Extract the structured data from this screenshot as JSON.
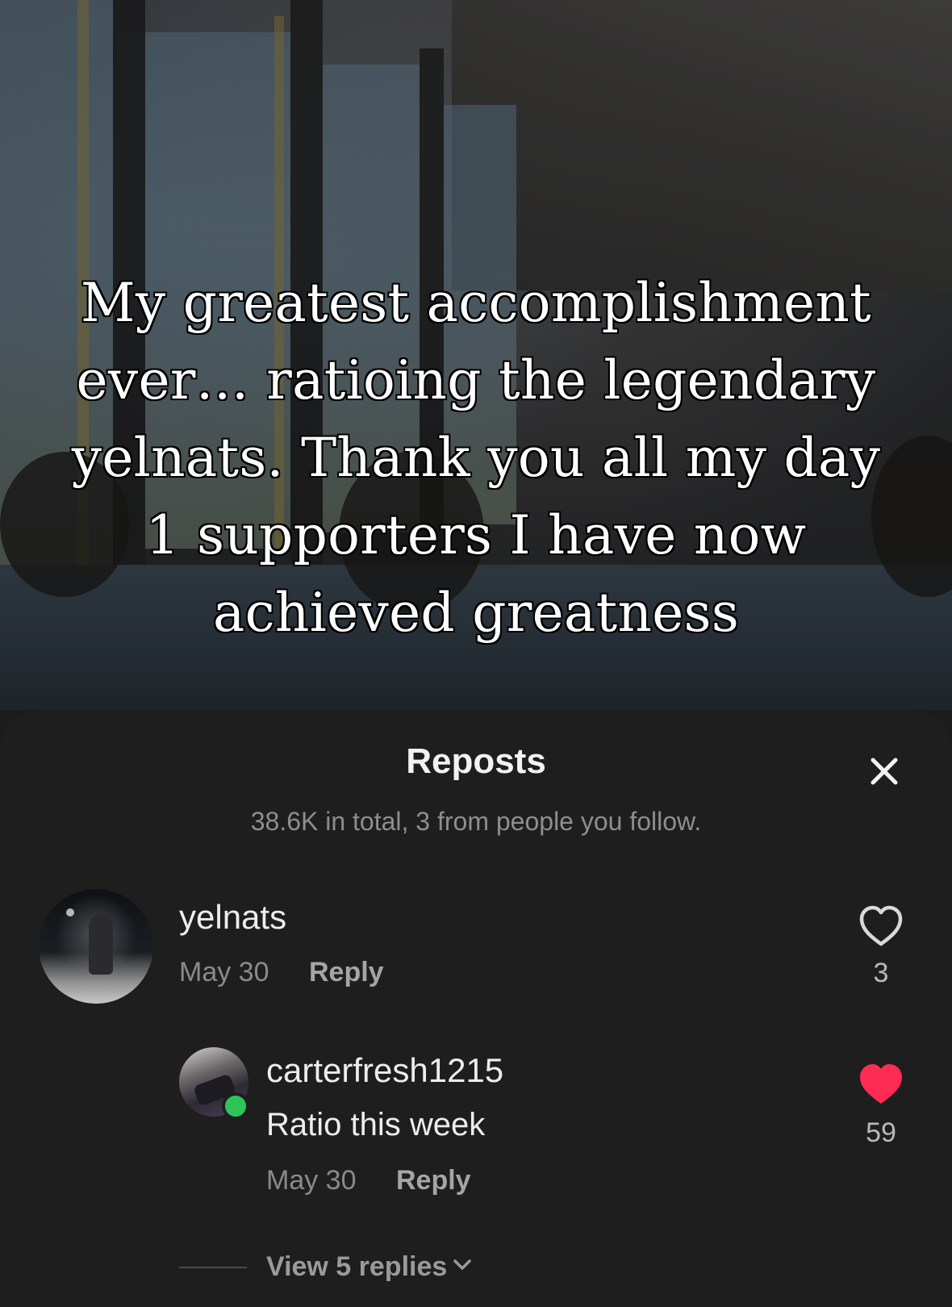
{
  "post": {
    "caption": "My greatest accomplishment ever… ratioing the legendary yelnats. Thank you all my day 1 supporters I have now achieved greatness"
  },
  "sheet": {
    "title": "Reposts",
    "subtitle": "38.6K in total, 3 from people you follow."
  },
  "comments": [
    {
      "username": "yelnats",
      "date": "May 30",
      "reply_label": "Reply",
      "likes": "3",
      "liked": false
    },
    {
      "username": "carterfresh1215",
      "text": "Ratio this week",
      "date": "May 30",
      "reply_label": "Reply",
      "likes": "59",
      "liked": true,
      "online": true
    }
  ],
  "view_replies_label": "View 5 replies",
  "colors": {
    "like_active": "#fe2c55",
    "online": "#2ec45a",
    "sheet_bg": "#1e1e1e"
  },
  "icons": [
    "close-icon",
    "heart-outline-icon",
    "heart-filled-icon",
    "chevron-down-icon"
  ]
}
